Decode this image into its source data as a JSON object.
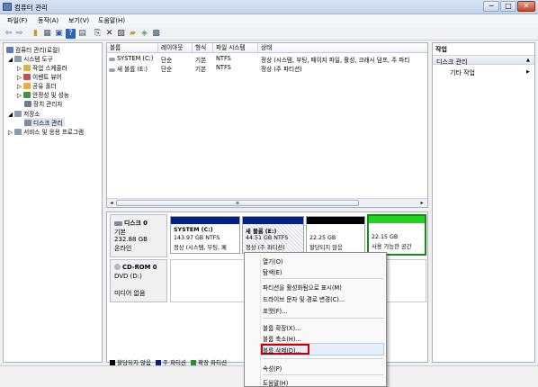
{
  "window": {
    "title": "컴퓨터 관리",
    "minimize": "─",
    "maximize": "□",
    "close": "✕"
  },
  "menubar": {
    "items": [
      "파일(F)",
      "동작(A)",
      "보기(V)",
      "도움말(H)"
    ]
  },
  "toolbar": {
    "icons": [
      "back-arrow-icon",
      "forward-arrow-icon",
      "up-folder-icon",
      "console-tree-icon",
      "properties-icon",
      "help-icon",
      "show-hide-icon",
      "export-icon",
      "delete-icon",
      "properties-sheet-icon",
      "open-icon",
      "wizard-icon",
      "refresh-icon"
    ]
  },
  "tree": {
    "root": "컴퓨터 관리(로컬)",
    "items": [
      {
        "label": "시스템 도구",
        "level": 1,
        "expanded": true
      },
      {
        "label": "작업 스케줄러",
        "level": 2
      },
      {
        "label": "이벤트 뷰어",
        "level": 2
      },
      {
        "label": "공유 폴더",
        "level": 2
      },
      {
        "label": "안정성 및 성능",
        "level": 2
      },
      {
        "label": "장치 관리자",
        "level": 2
      },
      {
        "label": "저장소",
        "level": 1,
        "expanded": true
      },
      {
        "label": "디스크 관리",
        "level": 2,
        "selected": true
      },
      {
        "label": "서비스 및 응용 프로그램",
        "level": 1
      }
    ]
  },
  "volume_table": {
    "headers": [
      "볼륨",
      "레이아웃",
      "형식",
      "파일 시스템",
      "상태"
    ],
    "rows": [
      [
        "SYSTEM (C:)",
        "단순",
        "기본",
        "NTFS",
        "정상 (시스템, 부팅, 페이지 파일, 활성, 크래시 덤프, 주 파티"
      ],
      [
        "새 볼륨 (E:)",
        "단순",
        "기본",
        "NTFS",
        "정상 (주 파티션)"
      ]
    ],
    "scroll_mid": "≡"
  },
  "disks": [
    {
      "name": "디스크 0",
      "lines": [
        "기본",
        "232.88 GB",
        "온라인"
      ],
      "partitions": [
        {
          "title": "SYSTEM  (C:)",
          "size": "143.97 GB NTFS",
          "status": "정상 (시스템, 부팅, 페",
          "bar": "#001f87"
        },
        {
          "title": "새 볼륨  (E:)",
          "size": "44.51 GB NTFS",
          "status": "정상 (주 파티션)",
          "bar": "#001f87"
        },
        {
          "title": "",
          "size": "22.25 GB",
          "status": "할당되지 않음",
          "bar": "#000000"
        },
        {
          "title": "",
          "size": "22.15 GB",
          "status": "사용 가능한 공간",
          "bar": "#22d422"
        }
      ]
    },
    {
      "name": "CD-ROM 0",
      "lines": [
        "DVD (D:)",
        "",
        "미디어 없음"
      ]
    }
  ],
  "legend": [
    {
      "label": "할당되지 않음",
      "color": "#000000"
    },
    {
      "label": "주 파티션",
      "color": "#001f87"
    },
    {
      "label": "확장 파티션",
      "color": "#2e8b2e"
    }
  ],
  "actions": {
    "header": "작업",
    "section": "디스크 관리",
    "more": "기타 작업",
    "collapse": "▲",
    "arrow": "▶"
  },
  "context_menu": {
    "items": [
      {
        "label": "열기(O)"
      },
      {
        "label": "탐색(E)"
      },
      {
        "sep": true
      },
      {
        "label": "파티션을 활성화됨으로 표시(M)"
      },
      {
        "label": "드라이브 문자 및 경로 변경(C)..."
      },
      {
        "label": "포맷(F)..."
      },
      {
        "sep": true
      },
      {
        "label": "볼륨 확장(X)..."
      },
      {
        "label": "볼륨 축소(H)..."
      },
      {
        "label": "볼륨 삭제(D)...",
        "highlighted": true
      },
      {
        "sep": true
      },
      {
        "label": "속성(P)"
      },
      {
        "sep": true
      },
      {
        "label": "도움말(H)"
      }
    ],
    "highlight_color": "#cc0000"
  }
}
